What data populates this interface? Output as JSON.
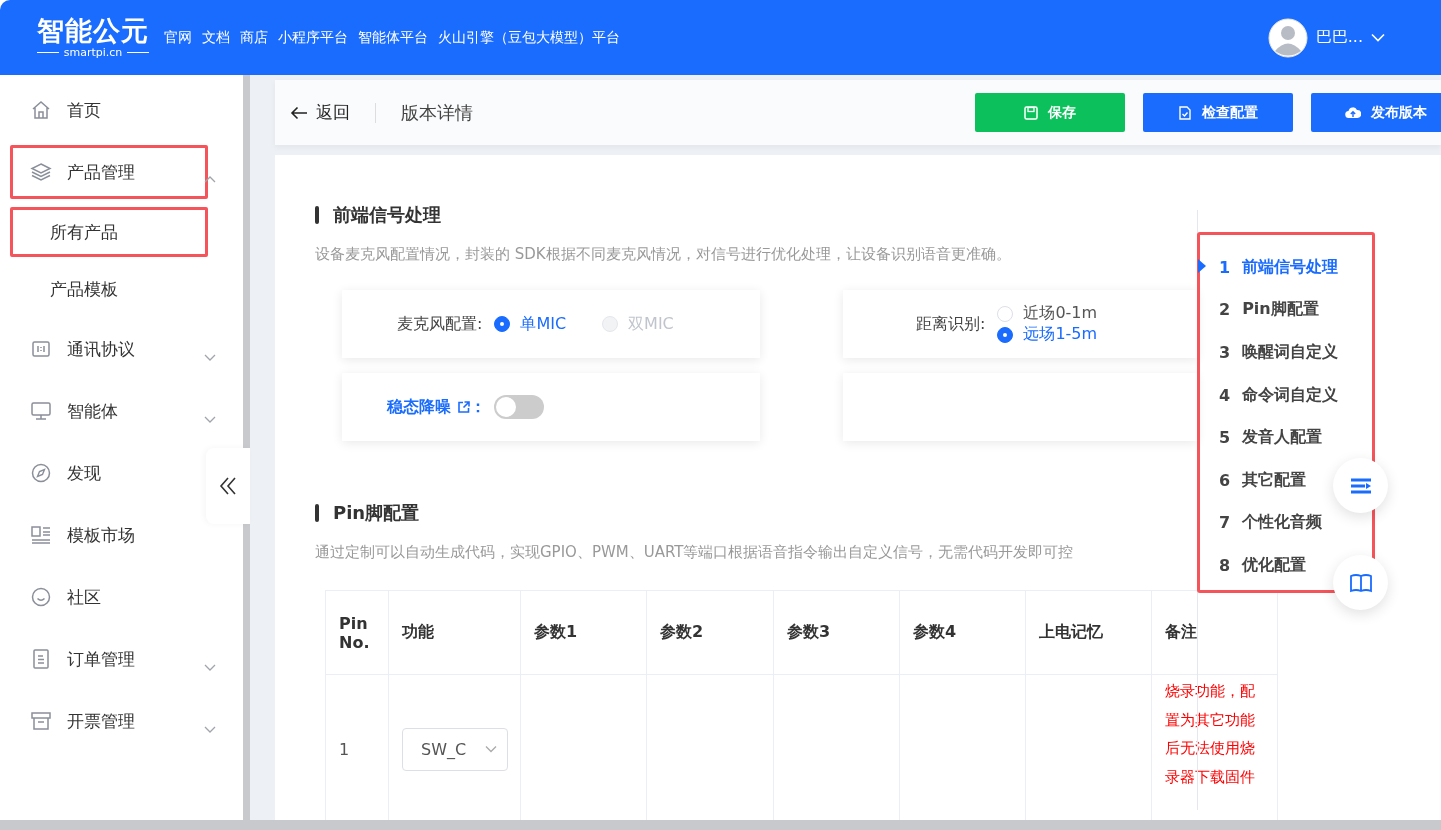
{
  "header": {
    "logo": "智能公元",
    "logo_sub": "smartpi.cn",
    "nav": [
      "官网",
      "文档",
      "商店",
      "小程序平台",
      "智能体平台",
      "火山引擎（豆包大模型）平台"
    ],
    "user": "巴巴..."
  },
  "sidebar": {
    "items": [
      {
        "label": "首页",
        "highlighted": false
      },
      {
        "label": "产品管理",
        "highlighted": true,
        "expanded": true,
        "children": [
          {
            "label": "所有产品",
            "highlighted": true
          },
          {
            "label": "产品模板",
            "highlighted": false
          }
        ]
      },
      {
        "label": "通讯协议",
        "highlighted": false,
        "expanded": false
      },
      {
        "label": "智能体",
        "highlighted": false,
        "expanded": false
      },
      {
        "label": "发现",
        "highlighted": false
      },
      {
        "label": "模板市场",
        "highlighted": false
      },
      {
        "label": "社区",
        "highlighted": false
      },
      {
        "label": "订单管理",
        "highlighted": false,
        "expanded": false
      },
      {
        "label": "开票管理",
        "highlighted": false,
        "expanded": false
      }
    ]
  },
  "topbar": {
    "back": "返回",
    "title": "版本详情",
    "buttons": [
      {
        "label": "保存",
        "kind": "success"
      },
      {
        "label": "检查配置",
        "kind": "primary"
      },
      {
        "label": "发布版本",
        "kind": "primary"
      }
    ]
  },
  "sections": [
    {
      "title": "前端信号处理",
      "description": "设备麦克风配置情况，封装的 SDK根据不同麦克风情况，对信号进行优化处理，让设备识别语音更准确。",
      "settings": [
        {
          "kind": "radio_row",
          "label": "麦克风配置:",
          "options": [
            {
              "label": "单MIC",
              "selected": true,
              "disabled": false
            },
            {
              "label": "双MIC",
              "selected": false,
              "disabled": true
            }
          ]
        },
        {
          "kind": "radio_column",
          "label": "距离识别:",
          "options": [
            {
              "label": "近场0-1m",
              "selected": false,
              "disabled": false
            },
            {
              "label": "远场1-5m",
              "selected": true,
              "disabled": false
            }
          ]
        },
        {
          "kind": "toggle",
          "label": "稳态降噪",
          "suffix": "：",
          "on": false
        },
        {
          "kind": "empty"
        }
      ]
    },
    {
      "title": "Pin脚配置",
      "description": "通过定制可以自动生成代码，实现GPIO、PWM、UART等端口根据语音指令输出自定义信号，无需代码开发即可控",
      "table": {
        "columns": [
          "Pin No.",
          "功能",
          "参数1",
          "参数2",
          "参数3",
          "参数4",
          "上电记忆",
          "备注"
        ],
        "rows": [
          {
            "pin": "1",
            "function": "SW_C",
            "note": "烧录功能，配置为其它功能后无法使用烧录器下载固件"
          }
        ]
      }
    }
  ],
  "toc": {
    "highlighted": true,
    "items": [
      {
        "number": "1",
        "label": "前端信号处理",
        "selected": true
      },
      {
        "number": "2",
        "label": "Pin脚配置",
        "selected": false
      },
      {
        "number": "3",
        "label": "唤醒词自定义",
        "selected": false
      },
      {
        "number": "4",
        "label": "命令词自定义",
        "selected": false
      },
      {
        "number": "5",
        "label": "发音人配置",
        "selected": false
      },
      {
        "number": "6",
        "label": "其它配置",
        "selected": false
      },
      {
        "number": "7",
        "label": "个性化音频",
        "selected": false
      },
      {
        "number": "8",
        "label": "优化配置",
        "selected": false
      }
    ]
  }
}
